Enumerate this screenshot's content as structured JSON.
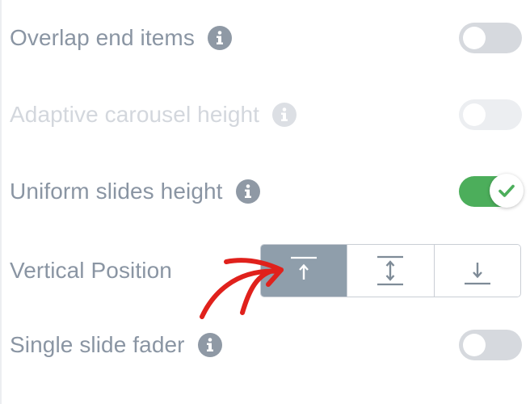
{
  "settings": {
    "overlap_end_items": {
      "label": "Overlap end items",
      "enabled": false,
      "disabled": false
    },
    "adaptive_carousel_height": {
      "label": "Adaptive carousel height",
      "enabled": false,
      "disabled": true
    },
    "uniform_slides_height": {
      "label": "Uniform slides height",
      "enabled": true,
      "disabled": false
    },
    "vertical_position": {
      "label": "Vertical Position",
      "options": [
        "top",
        "middle",
        "bottom"
      ],
      "selected": "top"
    },
    "single_slide_fader": {
      "label": "Single slide fader",
      "enabled": false,
      "disabled": false
    }
  },
  "colors": {
    "label": "#8a95a3",
    "toggle_on": "#4cae5b",
    "toggle_off": "#d6d9de",
    "segment_active": "#8f9eab",
    "annotation_arrow": "#e0211c"
  },
  "icons": {
    "info": "info-icon",
    "check": "check-icon",
    "align_top": "align-top-icon",
    "align_middle": "align-middle-icon",
    "align_bottom": "align-bottom-icon",
    "annotation": "red-hand-drawn-arrow"
  }
}
